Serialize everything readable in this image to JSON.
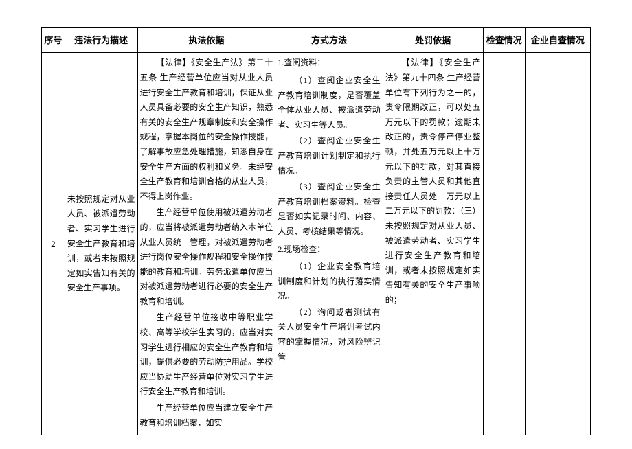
{
  "headers": {
    "seq": "序号",
    "desc": "违法行为描述",
    "basis": "执法依据",
    "method": "方式方法",
    "penalty": "处罚依据",
    "check": "检查情况",
    "self": "企业自查情况"
  },
  "row": {
    "seq": "2",
    "desc": "未按照规定对从业人员、被派遣劳动者、实习学生进行安全生产教育和培训，或者未按照规定如实告知有关的安全生产事项。",
    "basis": {
      "p1": "【法律】《安全生产法》第二十五条 生产经营单位应当对从业人员进行安全生产教育和培训，保证从业人员具备必要的安全生产知识，熟悉有关的安全生产规章制度和安全操作规程，掌握本岗位的安全操作技能，了解事故应急处理措施，知悉自身在安全生产方面的权利和义务。未经安全生产教育和培训合格的从业人员，不得上岗作业。",
      "p2": "生产经营单位使用被派遣劳动者的，应当将被派遣劳动者纳入本单位从业人员统一管理，对被派遣劳动者进行岗位安全操作规程和安全操作技能的教育和培训。劳务派遣单位应当对被派遣劳动者进行必要的安全生产教育和培训。",
      "p3": "生产经营单位接收中等职业学校、高等学校学生实习的，应当对实习学生进行相应的安全生产教育和培训，提供必要的劳动防护用品。学校应当协助生产经营单位对实习学生进行安全生产教育和培训。",
      "p4": "生产经营单位应当建立安全生产教育和培训档案，如实"
    },
    "method": {
      "h1": "1.查阅资料：",
      "m1": "（1）查阅企业安全生产教育培训制度，是否覆盖全体从业人员、被派遣劳动者、实习生等人员。",
      "m2": "（2）查阅企业安全生产教育培训计划制定和执行情况。",
      "m3": "（3）查阅企业安全生产教育培训档案资料。检查是否如实记录时间、内容、人员、考核结果等情况。",
      "h2": "2.现场检查：",
      "m4": "（1）企业安全教育培训制度和计划的执行落实情况。",
      "m5": "（2）询问或者测试有关人员安全生产培训考试内容的掌握情况，对风险辨识管"
    },
    "penalty": {
      "p1": "【法律】《安全生产法》第九十四条 生产经营单位有下列行为之一的，责令限期改正，可以处五万元以下的罚款；逾期未改正的，责令停产停业整顿，并处五万元以上十万元以下的罚款，对其直接负责的主管人员和其他直接责任人员处一万元以上二万元以下的罚款：（三）未按照规定对从业人员、被派遣劳动者、实习学生进行安全生产教育和培训，或者未按照规定如实告知有关的安全生产事项的；"
    }
  }
}
